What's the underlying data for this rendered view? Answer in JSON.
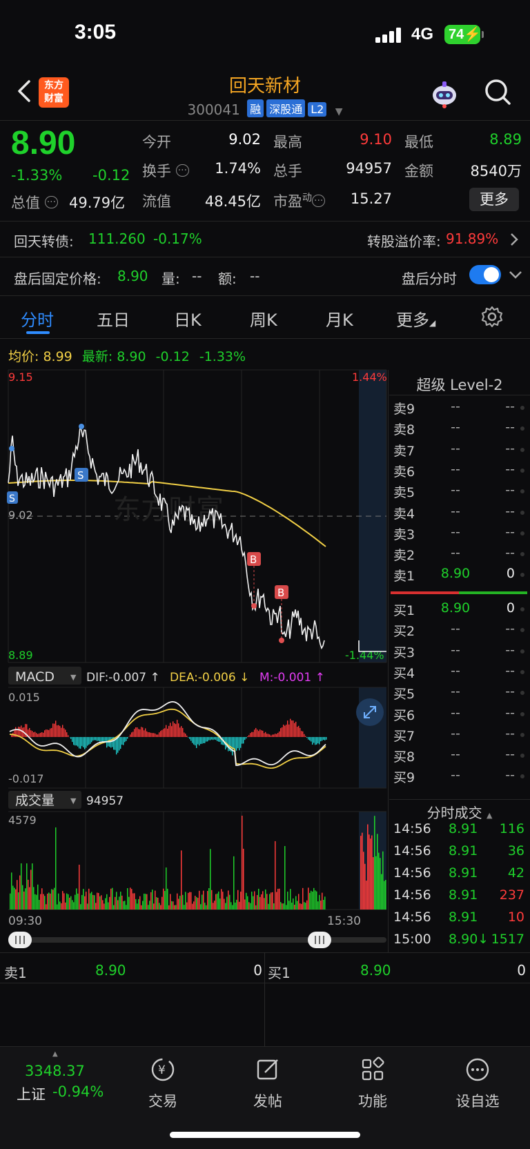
{
  "status": {
    "time": "3:05",
    "network": "4G",
    "battery": "74"
  },
  "header": {
    "logo_line1": "东方",
    "logo_line2": "财富",
    "name": "回天新材",
    "code": "300041",
    "tags": [
      "融",
      "深股通",
      "L2"
    ]
  },
  "quote": {
    "price": "8.90",
    "pct": "-1.33%",
    "change": "-0.12",
    "mktcap_label": "总值",
    "mktcap": "49.79亿",
    "open_label": "今开",
    "open": "9.02",
    "high_label": "最高",
    "high": "9.10",
    "low_label": "最低",
    "low": "8.89",
    "turnover_label": "换手",
    "turnover": "1.74%",
    "volume_label": "总手",
    "volume": "94957",
    "amount_label": "金额",
    "amount": "8540万",
    "float_label": "流值",
    "float": "48.45亿",
    "pe_label": "市盈",
    "pe_sup": "动",
    "pe": "15.27",
    "more": "更多"
  },
  "bond": {
    "label": "回天转债:",
    "price": "111.260",
    "pct": "-0.17%",
    "premium_label": "转股溢价率:",
    "premium": "91.89%"
  },
  "afterhours": {
    "label": "盘后固定价格:",
    "price": "8.90",
    "vol_label": "量:",
    "vol": "--",
    "amt_label": "额:",
    "amt": "--",
    "toggle_label": "盘后分时",
    "toggle_on": true
  },
  "tabs": [
    "分时",
    "五日",
    "日K",
    "周K",
    "月K",
    "更多"
  ],
  "chart_info": {
    "avg_label": "均价:",
    "avg": "8.99",
    "latest_label": "最新:",
    "latest": "8.90",
    "latest_chg": "-0.12",
    "latest_pct": "-1.33%",
    "y_max": "9.15",
    "y_min": "8.89",
    "y_ref": "9.02",
    "pct_max": "1.44%",
    "pct_min": "-1.44%",
    "watermark": "东方财富",
    "marker_buy": "B",
    "marker_sell": "S"
  },
  "macd": {
    "label": "MACD",
    "dif": "DIF:-0.007 ↑",
    "dea": "DEA:-0.006 ↓",
    "m": "M:-0.001 ↑",
    "y_max": "0.015",
    "y_min": "-0.017"
  },
  "volume_panel": {
    "label": "成交量",
    "total": "94957",
    "y_max": "4579",
    "t_start": "09:30",
    "t_end": "15:30"
  },
  "level2": {
    "title": "超级 Level-2",
    "asks": [
      {
        "label": "卖9",
        "price": "--",
        "vol": "--"
      },
      {
        "label": "卖8",
        "price": "--",
        "vol": "--"
      },
      {
        "label": "卖7",
        "price": "--",
        "vol": "--"
      },
      {
        "label": "卖6",
        "price": "--",
        "vol": "--"
      },
      {
        "label": "卖5",
        "price": "--",
        "vol": "--"
      },
      {
        "label": "卖4",
        "price": "--",
        "vol": "--"
      },
      {
        "label": "卖3",
        "price": "--",
        "vol": "--"
      },
      {
        "label": "卖2",
        "price": "--",
        "vol": "--"
      },
      {
        "label": "卖1",
        "price": "8.90",
        "vol": "0"
      }
    ],
    "bids": [
      {
        "label": "买1",
        "price": "8.90",
        "vol": "0"
      },
      {
        "label": "买2",
        "price": "--",
        "vol": "--"
      },
      {
        "label": "买3",
        "price": "--",
        "vol": "--"
      },
      {
        "label": "买4",
        "price": "--",
        "vol": "--"
      },
      {
        "label": "买5",
        "price": "--",
        "vol": "--"
      },
      {
        "label": "买6",
        "price": "--",
        "vol": "--"
      },
      {
        "label": "买7",
        "price": "--",
        "vol": "--"
      },
      {
        "label": "买8",
        "price": "--",
        "vol": "--"
      },
      {
        "label": "买9",
        "price": "--",
        "vol": "--"
      }
    ]
  },
  "ticks": {
    "title": "分时成交",
    "rows": [
      {
        "time": "14:56",
        "price": "8.91",
        "vol": "116",
        "color": "#1fd12b"
      },
      {
        "time": "14:56",
        "price": "8.91",
        "vol": "36",
        "color": "#1fd12b"
      },
      {
        "time": "14:56",
        "price": "8.91",
        "vol": "42",
        "color": "#1fd12b"
      },
      {
        "time": "14:56",
        "price": "8.91",
        "vol": "237",
        "color": "#ff3b3b"
      },
      {
        "time": "14:56",
        "price": "8.91",
        "vol": "10",
        "color": "#ff3b3b"
      },
      {
        "time": "15:00",
        "price": "8.90↓",
        "vol": "1517",
        "color": "#1fd12b"
      }
    ]
  },
  "bottom_book": {
    "ask_label": "卖1",
    "ask_price": "8.90",
    "ask_vol": "0",
    "bid_label": "买1",
    "bid_price": "8.90",
    "bid_vol": "0"
  },
  "nav": {
    "index_value": "3348.37",
    "index_name": "上证",
    "index_pct": "-0.94%",
    "items": [
      "交易",
      "发帖",
      "功能",
      "设自选"
    ]
  },
  "colors": {
    "up": "#ff3b3b",
    "down": "#1fd12b",
    "accent": "#2f8cff",
    "avg_line": "#f2d046",
    "brand": "#f5a623"
  }
}
